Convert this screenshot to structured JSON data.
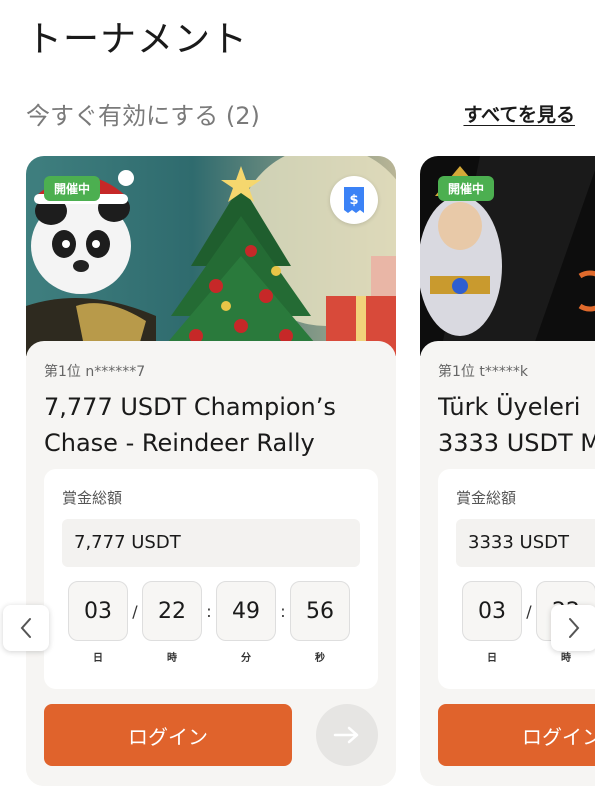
{
  "header": {
    "title": "トーナメント"
  },
  "section": {
    "title": "今すぐ有効にする (2)",
    "see_all": "すべてを見る"
  },
  "colors": {
    "accent": "#e0632c",
    "badge_green": "#4caf50",
    "ticket_blue": "#3b82f6"
  },
  "cards": [
    {
      "status": "開催中",
      "leader": "第1位 n******7",
      "name_line1": "7,777 USDT Champion’s",
      "name_line2": "Chase - Reindeer Rally",
      "prize_label": "賞金総額",
      "prize_value": "7,777 USDT",
      "countdown": [
        {
          "value": "03",
          "label": "日"
        },
        {
          "value": "22",
          "label": "時"
        },
        {
          "value": "49",
          "label": "分"
        },
        {
          "value": "56",
          "label": "秒"
        }
      ],
      "separators": [
        "/",
        ":",
        ":"
      ],
      "login_label": "ログイン",
      "ticket_icon": "ticket-dollar-icon",
      "arrow_icon": "arrow-right-icon"
    },
    {
      "status": "開催中",
      "leader": "第1位 t*****k",
      "name_line1": "Türk Üyeleri",
      "name_line2": "3333 USDT M",
      "prize_label": "賞金総額",
      "prize_value": "3333 USDT",
      "countdown": [
        {
          "value": "03",
          "label": "日"
        },
        {
          "value": "22",
          "label": "時"
        }
      ],
      "separators": [
        "/"
      ],
      "login_label": "ログイン"
    }
  ],
  "nav": {
    "prev_icon": "chevron-left-icon",
    "next_icon": "chevron-right-icon"
  }
}
